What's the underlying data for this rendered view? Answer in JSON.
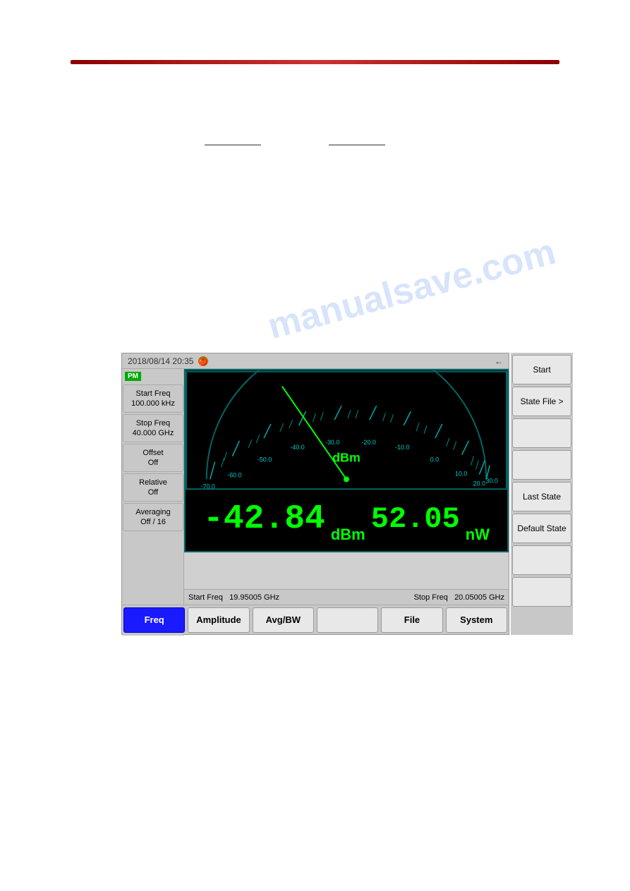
{
  "page": {
    "background": "#ffffff"
  },
  "watermark": {
    "text": "manualsave.com"
  },
  "top_bar": {
    "color": "#8B0000"
  },
  "instrument": {
    "title_bar": {
      "datetime": "2018/08/14 20:35",
      "back_arrow": "←"
    },
    "pm_badge": "PM",
    "left_panel": {
      "start_freq_label": "Start Freq",
      "start_freq_value": "100.000 kHz",
      "stop_freq_label": "Stop Freq",
      "stop_freq_value": "40.000 GHz",
      "offset_label": "Offset",
      "offset_value": "Off",
      "relative_label": "Relative",
      "relative_value": "Off",
      "averaging_label": "Averaging",
      "averaging_value": "Off / 16"
    },
    "meter": {
      "unit_label": "dBm",
      "scale_marks": [
        "-70.0",
        "-60.0",
        "-50.0",
        "-40.0",
        "-30.0",
        "-20.0",
        "-10.0",
        "0.0",
        "10.0",
        "20.0",
        "30.0"
      ]
    },
    "reading": {
      "primary_value": "-42.84",
      "primary_unit": "dBm",
      "secondary_value": "52.05",
      "secondary_unit": "nW"
    },
    "status_bar": {
      "start_freq_label": "Start Freq",
      "start_freq_value": "19.95005 GHz",
      "stop_freq_label": "Stop Freq",
      "stop_freq_value": "20.05005 GHz"
    },
    "tabs": [
      {
        "id": "freq",
        "label": "Freq",
        "active": true
      },
      {
        "id": "amplitude",
        "label": "Amplitude",
        "active": false
      },
      {
        "id": "avg_bw",
        "label": "Avg/BW",
        "active": false
      },
      {
        "id": "blank",
        "label": "",
        "active": false
      },
      {
        "id": "file",
        "label": "File",
        "active": false
      },
      {
        "id": "system",
        "label": "System",
        "active": false
      }
    ]
  },
  "right_sidebar": {
    "buttons": [
      {
        "id": "start",
        "label": "Start"
      },
      {
        "id": "state_file",
        "label": "State File >"
      },
      {
        "id": "blank1",
        "label": ""
      },
      {
        "id": "blank2",
        "label": ""
      },
      {
        "id": "last_state",
        "label": "Last State"
      },
      {
        "id": "default_state",
        "label": "Default State"
      },
      {
        "id": "blank3",
        "label": ""
      },
      {
        "id": "blank4",
        "label": ""
      }
    ]
  }
}
